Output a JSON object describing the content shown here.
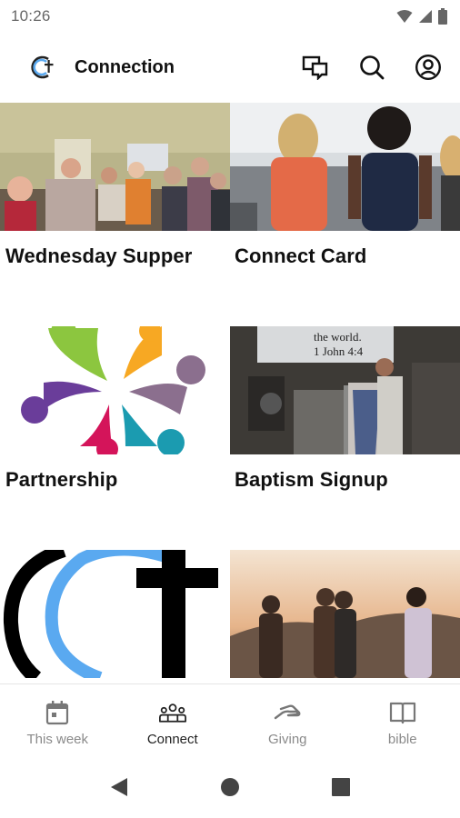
{
  "status_bar": {
    "time": "10:26"
  },
  "app_bar": {
    "title": "Connection"
  },
  "cards": [
    {
      "title": "Wednesday Supper"
    },
    {
      "title": "Connect Card"
    },
    {
      "title": "Partnership"
    },
    {
      "title": "Baptism Signup"
    },
    {
      "title": ""
    },
    {
      "title": ""
    }
  ],
  "baptism_image_text": {
    "line1": "the world.",
    "line2": "1 John 4:4"
  },
  "bottom_nav": {
    "items": [
      {
        "label": "This week",
        "icon": "calendar-icon"
      },
      {
        "label": "Connect",
        "icon": "people-icon",
        "active": true
      },
      {
        "label": "Giving",
        "icon": "giving-hand-icon"
      },
      {
        "label": "bible",
        "icon": "book-icon"
      }
    ]
  },
  "colors": {
    "accent_blue": "#5aa9f0",
    "text": "#111111",
    "nav_inactive": "#8a8a8a"
  }
}
